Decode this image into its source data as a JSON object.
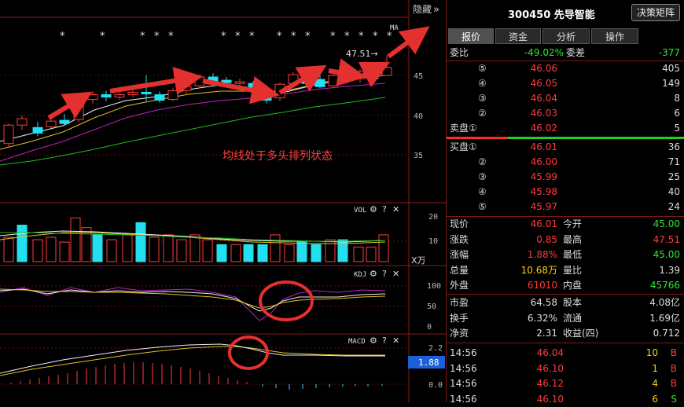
{
  "chart": {
    "collapse_label": "隐藏",
    "collapse_icon": "»",
    "ma_label": "MA",
    "star_marks": [
      "*",
      "*",
      "*",
      "*",
      "*",
      "*",
      "*",
      "*",
      "*",
      "*",
      "*",
      "*",
      "*",
      "*",
      "*",
      "*"
    ],
    "high_label": "47.51→",
    "price_axis": [
      "45",
      "40",
      "35"
    ],
    "annotation": "均线处于多头排列状态",
    "vol_label": "VOL",
    "vol_axis": [
      "20",
      "10"
    ],
    "vol_unit": "X万",
    "kdj_label": "KDJ",
    "kdj_axis": [
      "100",
      "50",
      "0"
    ],
    "macd_label": "MACD",
    "macd_axis": [
      "2.2",
      "0.0"
    ],
    "macd_current": "1.88",
    "help_mark": "?",
    "close_mark": "✕"
  },
  "header": {
    "title": "300450 先导智能",
    "decision_button": "决策矩阵"
  },
  "tabs": [
    "报价",
    "资金",
    "分析",
    "操作"
  ],
  "weibi": {
    "label": "委比",
    "value": "-49.02%",
    "diff_label": "委差",
    "diff": "-377"
  },
  "sell_orders": [
    {
      "level": "⑤",
      "price": "46.06",
      "vol": "405"
    },
    {
      "level": "④",
      "price": "46.05",
      "vol": "149"
    },
    {
      "level": "③",
      "price": "46.04",
      "vol": "8"
    },
    {
      "level": "②",
      "price": "46.03",
      "vol": "6"
    },
    {
      "level": "卖盘①",
      "price": "46.02",
      "vol": "5"
    }
  ],
  "buy_orders": [
    {
      "level": "买盘①",
      "price": "46.01",
      "vol": "36"
    },
    {
      "level": "②",
      "price": "46.00",
      "vol": "71"
    },
    {
      "level": "③",
      "price": "45.99",
      "vol": "25"
    },
    {
      "level": "④",
      "price": "45.98",
      "vol": "40"
    },
    {
      "level": "⑤",
      "price": "45.97",
      "vol": "24"
    }
  ],
  "quote": [
    {
      "l1": "现价",
      "v1": "46.01",
      "c1": "r",
      "l2": "今开",
      "v2": "45.00",
      "c2": "g"
    },
    {
      "l1": "涨跌",
      "v1": "0.85",
      "c1": "r",
      "l2": "最高",
      "v2": "47.51",
      "c2": "r"
    },
    {
      "l1": "涨幅",
      "v1": "1.88%",
      "c1": "r",
      "l2": "最低",
      "v2": "45.00",
      "c2": "g"
    },
    {
      "l1": "总量",
      "v1": "10.68万",
      "c1": "y",
      "l2": "量比",
      "v2": "1.39",
      "c2": "w"
    },
    {
      "l1": "外盘",
      "v1": "61010",
      "c1": "r",
      "l2": "内盘",
      "v2": "45766",
      "c2": "g"
    }
  ],
  "fundamentals": [
    {
      "l1": "市盈",
      "v1": "64.58",
      "l2": "股本",
      "v2": "4.08亿"
    },
    {
      "l1": "换手",
      "v1": "6.32%",
      "l2": "流通",
      "v2": "1.69亿"
    },
    {
      "l1": "净资",
      "v1": "2.31",
      "l2": "收益(四)",
      "v2": "0.712"
    }
  ],
  "ticks": [
    {
      "time": "14:56",
      "price": "46.04",
      "vol": "10",
      "side": "B"
    },
    {
      "time": "14:56",
      "price": "46.10",
      "vol": "1",
      "side": "B"
    },
    {
      "time": "14:56",
      "price": "46.12",
      "vol": "4",
      "side": "B"
    },
    {
      "time": "14:56",
      "price": "46.10",
      "vol": "6",
      "side": "S"
    }
  ]
}
